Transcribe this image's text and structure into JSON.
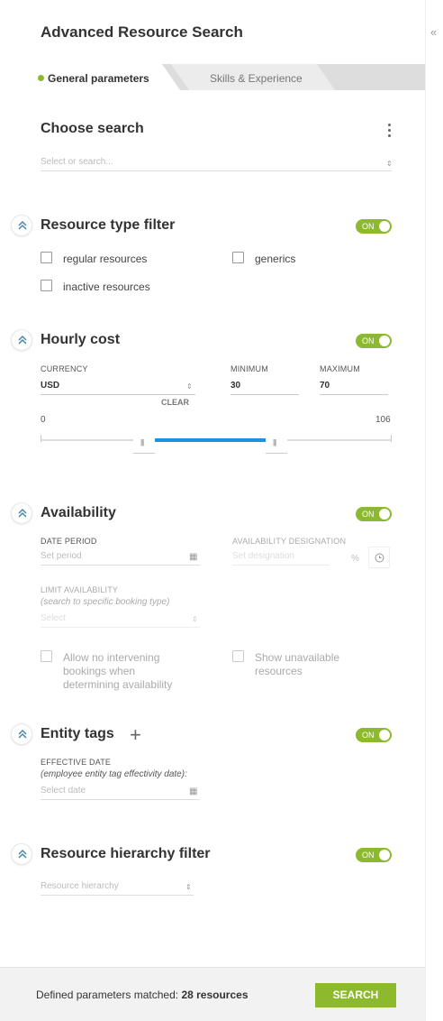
{
  "title": "Advanced Resource Search",
  "collapse_icon": "«",
  "tabs": [
    {
      "label": "General parameters",
      "active": true
    },
    {
      "label": "Skills & Experience",
      "active": false
    }
  ],
  "choose_search": {
    "title": "Choose search",
    "placeholder": "Select or search..."
  },
  "resource_type": {
    "title": "Resource type filter",
    "toggle": "ON",
    "options": [
      {
        "label": "regular resources",
        "checked": false
      },
      {
        "label": "generics",
        "checked": false
      },
      {
        "label": "inactive resources",
        "checked": false
      }
    ]
  },
  "hourly_cost": {
    "title": "Hourly cost",
    "toggle": "ON",
    "currency_label": "CURRENCY",
    "currency_value": "USD",
    "minimum_label": "MINIMUM",
    "minimum_value": "30",
    "maximum_label": "MAXIMUM",
    "maximum_value": "70",
    "clear_label": "CLEAR",
    "range_min": "0",
    "range_max": "106"
  },
  "availability": {
    "title": "Availability",
    "toggle": "ON",
    "date_period_label": "DATE PERIOD",
    "date_period_placeholder": "Set period",
    "designation_label": "AVAILABILITY DESIGNATION",
    "designation_placeholder": "Set designation",
    "percent_symbol": "%",
    "limit_label": "LIMIT AVAILABILITY",
    "limit_hint": "(search to specific booking type)",
    "limit_placeholder": "Select",
    "option_no_intervening": "Allow no intervening bookings when determining availability",
    "option_show_unavailable": "Show unavailable resources"
  },
  "entity_tags": {
    "title": "Entity tags",
    "add_icon": "+",
    "toggle": "ON",
    "effective_date_label": "EFFECTIVE DATE",
    "effective_date_hint": "(employee entity tag effectivity date):",
    "effective_date_placeholder": "Select date"
  },
  "hierarchy": {
    "title": "Resource hierarchy filter",
    "toggle": "ON",
    "placeholder": "Resource hierarchy"
  },
  "footer": {
    "matched_prefix": "Defined parameters matched:",
    "matched_count": "28 resources",
    "search_label": "SEARCH"
  },
  "colors": {
    "accent": "#8db92e",
    "slider": "#1e90e0"
  }
}
